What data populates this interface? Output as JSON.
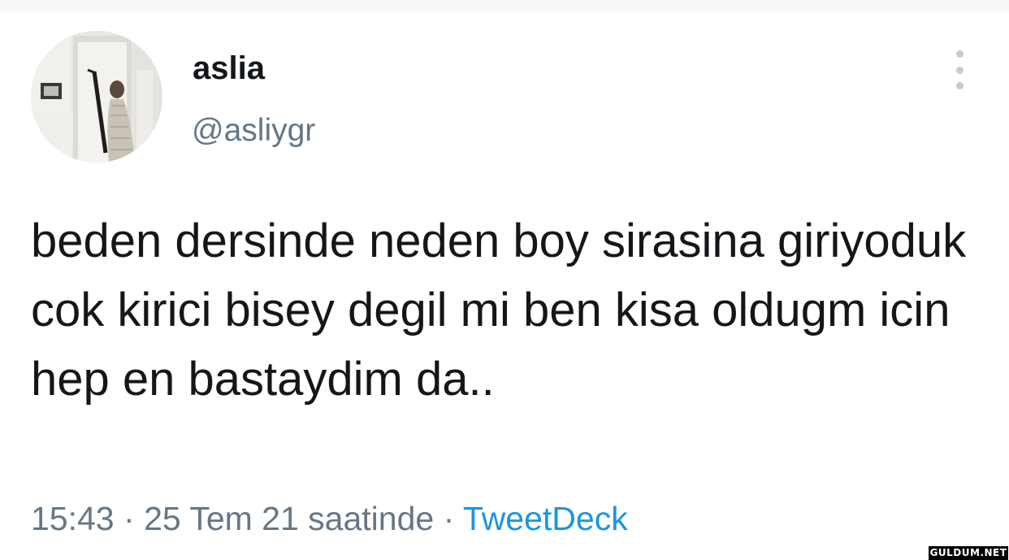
{
  "tweet": {
    "display_name": "aslia",
    "handle": "@asliygr",
    "text": "beden dersinde neden boy sirasina giriyoduk cok kirici bisey degil mi ben kisa oldugm icin hep en bastaydim da..",
    "time": "15:43",
    "separator": "·",
    "date_text": "25 Tem 21 saatinde",
    "source": "TweetDeck"
  },
  "watermark": {
    "text": "GULDUM.NET"
  },
  "icons": {
    "more": "more-vertical-icon",
    "avatar": "profile-photo"
  },
  "colors": {
    "text": "#14171a",
    "secondary": "#657786",
    "link": "#1b95e0",
    "more_dots": "#c4cbd1"
  }
}
